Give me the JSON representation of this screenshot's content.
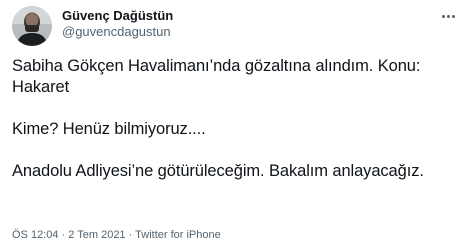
{
  "author": {
    "display_name": "Güvenç Dağüstün",
    "username": "@guvencdagustun"
  },
  "tweet": {
    "paragraphs": [
      "Sabiha Gökçen Havalimanı’nda gözaltına alındım. Konu: Hakaret",
      "Kime? Henüz bilmiyoruz....",
      "Anadolu Adliyesi’ne götürüleceğim. Bakalım anlayacağız."
    ]
  },
  "meta": {
    "time": "ÖS 12:04",
    "separator1": " · ",
    "date": "2 Tem 2021",
    "separator2": " · ",
    "source": "Twitter for iPhone"
  },
  "icons": {
    "avatar": "profile-photo",
    "more": "more-options-icon"
  }
}
